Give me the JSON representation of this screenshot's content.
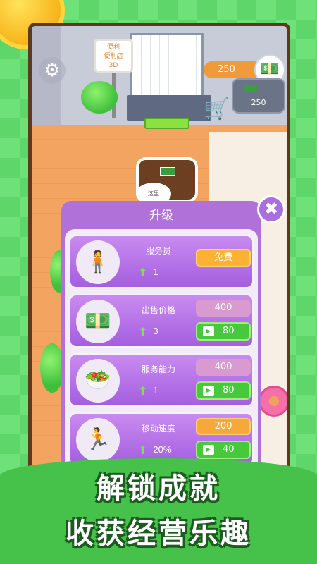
{
  "game": {
    "sign_text": [
      "便利",
      "便利店",
      "3D"
    ],
    "top_price": "250",
    "pad_price": "250",
    "hint": "这里"
  },
  "panel": {
    "title": "升级",
    "close_label": "✖",
    "upgrades": [
      {
        "name": "服务员",
        "level": "1",
        "icon": "person-icon",
        "free_label": "免费"
      },
      {
        "name": "出售价格",
        "level": "3",
        "icon": "cash-icon",
        "price": "400",
        "ad_price": "80"
      },
      {
        "name": "服务能力",
        "level": "1",
        "icon": "stack-icon",
        "price": "400",
        "ad_price": "80"
      },
      {
        "name": "移动速度",
        "level": "20%",
        "icon": "runner-icon",
        "price": "200",
        "ad_price": "40"
      }
    ]
  },
  "banner": {
    "line1": "解锁成就",
    "line2": "收获经营乐趣"
  },
  "colors": {
    "panel": "#b071d9",
    "ad_button": "#48c83c",
    "free_button": "#fbb234"
  }
}
